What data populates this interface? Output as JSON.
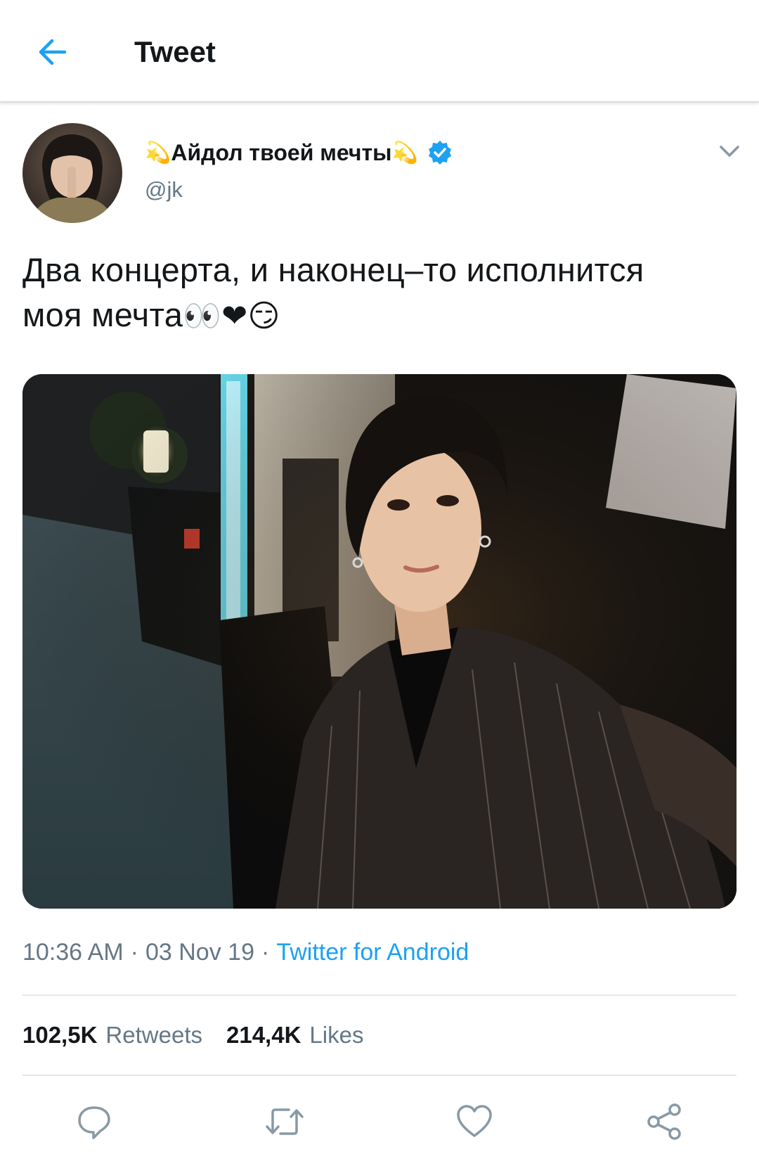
{
  "header": {
    "title": "Tweet",
    "back_icon": "arrow-left-icon",
    "accent": "#1da1f2"
  },
  "author": {
    "display_name": "Айдол твоей мечты",
    "name_emoji": "💫",
    "handle": "@jk",
    "verified": true,
    "verified_icon": "verified-badge-icon"
  },
  "tweet": {
    "text_line1": "Два концерта, и наконец–то исполнится",
    "text_line2": "моя мечта",
    "text_emojis": "👀❤😏"
  },
  "meta": {
    "time": "10:36 AM",
    "date": "03 Nov 19",
    "separator": "·",
    "source": "Twitter for Android"
  },
  "stats": {
    "retweets_count": "102,5K",
    "retweets_label": "Retweets",
    "likes_count": "214,4K",
    "likes_label": "Likes"
  },
  "actions": {
    "reply_icon": "reply-icon",
    "retweet_icon": "retweet-icon",
    "like_icon": "heart-icon",
    "share_icon": "share-icon"
  },
  "colors": {
    "text_primary": "#14171a",
    "text_secondary": "#657786",
    "link": "#1da1f2",
    "divider": "#e1e8ed"
  }
}
